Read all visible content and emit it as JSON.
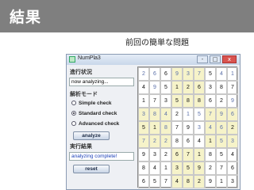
{
  "slide": {
    "title": "結果",
    "subtitle": "前回の簡単な問題"
  },
  "window": {
    "title": "NumPla3",
    "buttons": [
      "-",
      "□",
      "x"
    ]
  },
  "panel": {
    "progress_label": "進行状況",
    "progress_text": "now analyzing...",
    "mode_label": "解析モード",
    "modes": [
      {
        "label": "Simple check",
        "selected": false
      },
      {
        "label": "Standard check",
        "selected": true
      },
      {
        "label": "Advanced check",
        "selected": false
      }
    ],
    "analyze_label": "analyze",
    "result_label": "実行結果",
    "result_text": "analyzing complete!",
    "reset_label": "reset"
  },
  "colors": {
    "given": "#111111",
    "solved": "#5a6fa8",
    "highlight": "#f6f3c9",
    "result": "#1a3fb8"
  },
  "grid": [
    [
      "2",
      "6",
      "6",
      "9",
      "3",
      "7",
      "5",
      "4",
      "1"
    ],
    [
      "4",
      "9",
      "5",
      "1",
      "2",
      "6",
      "3",
      "8",
      "7"
    ],
    [
      "1",
      "7",
      "3",
      "5",
      "8",
      "8",
      "6",
      "2",
      "9"
    ],
    [
      "3",
      "8",
      "4",
      "2",
      "1",
      "5",
      "7",
      "9",
      "6"
    ],
    [
      "5",
      "1",
      "8",
      "7",
      "9",
      "3",
      "4",
      "6",
      "2"
    ],
    [
      "7",
      "2",
      "2",
      "8",
      "6",
      "4",
      "1",
      "5",
      "3"
    ],
    [
      "9",
      "3",
      "2",
      "6",
      "7",
      "1",
      "8",
      "5",
      "4"
    ],
    [
      "8",
      "4",
      "1",
      "3",
      "5",
      "9",
      "2",
      "7",
      "6"
    ],
    [
      "6",
      "5",
      "7",
      "4",
      "8",
      "2",
      "9",
      "1",
      "3"
    ]
  ],
  "given": [
    [
      0,
      0,
      1,
      0,
      0,
      0,
      1,
      0,
      0
    ],
    [
      1,
      0,
      1,
      1,
      1,
      1,
      1,
      1,
      1
    ],
    [
      1,
      1,
      1,
      1,
      1,
      1,
      1,
      1,
      0
    ],
    [
      0,
      0,
      0,
      1,
      0,
      0,
      0,
      0,
      0
    ],
    [
      1,
      1,
      0,
      1,
      1,
      0,
      0,
      0,
      1
    ],
    [
      0,
      0,
      0,
      1,
      1,
      1,
      1,
      0,
      0
    ],
    [
      1,
      1,
      1,
      1,
      1,
      1,
      1,
      1,
      1
    ],
    [
      1,
      1,
      1,
      1,
      1,
      1,
      1,
      1,
      1
    ],
    [
      1,
      1,
      1,
      1,
      1,
      1,
      1,
      1,
      1
    ]
  ],
  "highlight": [
    [
      0,
      0,
      0,
      1,
      1,
      1,
      0,
      0,
      0
    ],
    [
      0,
      0,
      0,
      1,
      1,
      1,
      0,
      0,
      0
    ],
    [
      0,
      0,
      0,
      1,
      1,
      1,
      0,
      0,
      0
    ],
    [
      1,
      1,
      1,
      0,
      0,
      0,
      1,
      1,
      1
    ],
    [
      1,
      1,
      1,
      0,
      0,
      0,
      1,
      1,
      1
    ],
    [
      1,
      1,
      1,
      0,
      0,
      0,
      1,
      1,
      1
    ],
    [
      0,
      0,
      0,
      1,
      1,
      1,
      0,
      0,
      0
    ],
    [
      0,
      0,
      0,
      1,
      1,
      1,
      0,
      0,
      0
    ],
    [
      0,
      0,
      0,
      1,
      1,
      1,
      0,
      0,
      0
    ]
  ]
}
